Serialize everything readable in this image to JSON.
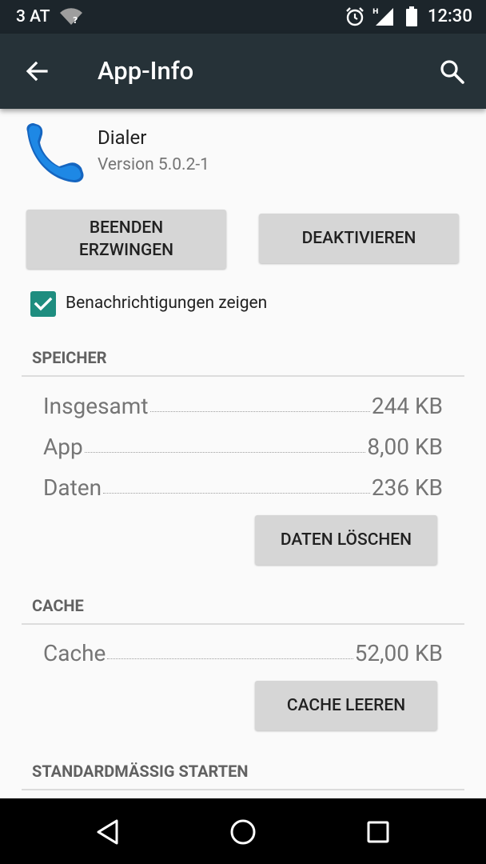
{
  "status_bar": {
    "carrier": "3 AT",
    "wifi_badge": "?",
    "network_type": "H",
    "time": "12:30"
  },
  "app_bar": {
    "title": "App-Info"
  },
  "app": {
    "name": "Dialer",
    "version": "Version 5.0.2-1"
  },
  "buttons": {
    "force_stop": "BEENDEN\nERZWINGEN",
    "disable": "DEAKTIVIEREN",
    "clear_data": "DATEN LÖSCHEN",
    "clear_cache": "CACHE LEEREN"
  },
  "notifications": {
    "label": "Benachrichtigungen zeigen",
    "checked": true
  },
  "storage": {
    "header": "SPEICHER",
    "rows": [
      {
        "label": "Insgesamt",
        "value": "244 KB"
      },
      {
        "label": "App",
        "value": "8,00 KB"
      },
      {
        "label": "Daten",
        "value": "236 KB"
      }
    ]
  },
  "cache": {
    "header": "CACHE",
    "rows": [
      {
        "label": "Cache",
        "value": "52,00 KB"
      }
    ]
  },
  "launch_default": {
    "header": "STANDARDMÄSSIG STARTEN"
  },
  "colors": {
    "app_bar": "#263238",
    "status_bar": "#1c252b",
    "accent": "#1e8d7f",
    "button": "#d6d6d6"
  }
}
